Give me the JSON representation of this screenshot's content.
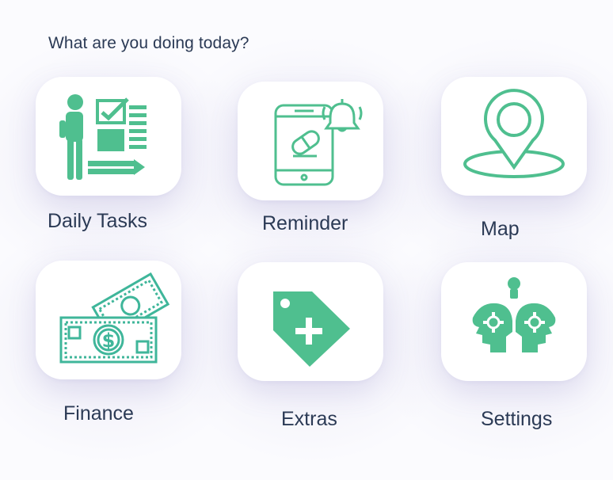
{
  "heading": "What are you doing today?",
  "accent_color": "#4fbf8f",
  "text_color": "#2b3a55",
  "tiles": [
    {
      "label": "Daily Tasks",
      "icon": "daily-tasks-icon"
    },
    {
      "label": "Reminder",
      "icon": "reminder-phone-bell-icon"
    },
    {
      "label": "Map",
      "icon": "map-pin-icon"
    },
    {
      "label": "Finance",
      "icon": "money-bills-icon"
    },
    {
      "label": "Extras",
      "icon": "price-tag-plus-icon"
    },
    {
      "label": "Settings",
      "icon": "heads-gears-idea-icon"
    }
  ]
}
